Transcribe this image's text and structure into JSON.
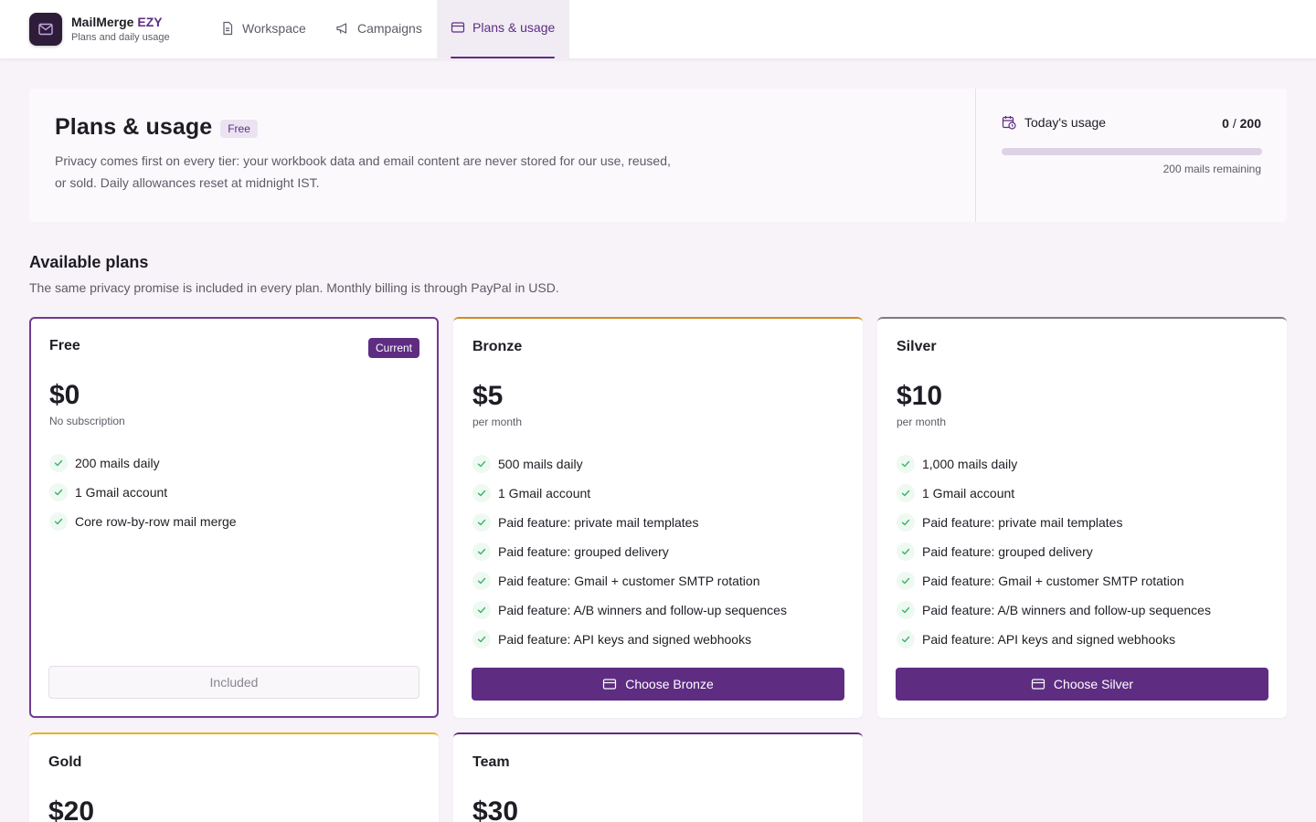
{
  "app": {
    "name": "MailMerge",
    "name_accent": "EZY",
    "subtitle": "Plans and daily usage"
  },
  "nav": {
    "tabs": [
      {
        "label": "Workspace",
        "icon": "document-icon"
      },
      {
        "label": "Campaigns",
        "icon": "megaphone-icon"
      },
      {
        "label": "Plans & usage",
        "icon": "credit-card-icon",
        "active": true
      }
    ]
  },
  "header": {
    "title": "Plans & usage",
    "plan_badge": "Free",
    "description": "Privacy comes first on every tier: your workbook data and email content are never stored for our use, reused, or sold. Daily allowances reset at midnight IST."
  },
  "usage": {
    "label": "Today's usage",
    "used": "0",
    "separator": "/",
    "limit": "200",
    "progress_fraction": 0,
    "remaining": "200 mails remaining"
  },
  "plans_section": {
    "title": "Available plans",
    "subtitle": "The same privacy promise is included in every plan. Monthly billing is through PayPal in USD."
  },
  "plans": [
    {
      "name": "Free",
      "badge": "Current",
      "price": "$0",
      "period": "No subscription",
      "accent": "#6e3a93",
      "features": [
        "200 mails daily",
        "1 Gmail account",
        "Core row-by-row mail merge"
      ],
      "button": "Included"
    },
    {
      "name": "Bronze",
      "price": "$5",
      "period": "per month",
      "accent": "#d08a22",
      "features": [
        "500 mails daily",
        "1 Gmail account",
        "Paid feature: private mail templates",
        "Paid feature: grouped delivery",
        "Paid feature: Gmail + customer SMTP rotation",
        "Paid feature: A/B winners and follow-up sequences",
        "Paid feature: API keys and signed webhooks"
      ],
      "button": "Choose Bronze"
    },
    {
      "name": "Silver",
      "price": "$10",
      "period": "per month",
      "accent": "#7c7a83",
      "features": [
        "1,000 mails daily",
        "1 Gmail account",
        "Paid feature: private mail templates",
        "Paid feature: grouped delivery",
        "Paid feature: Gmail + customer SMTP rotation",
        "Paid feature: A/B winners and follow-up sequences",
        "Paid feature: API keys and signed webhooks"
      ],
      "button": "Choose Silver"
    },
    {
      "name": "Gold",
      "price": "$20",
      "accent": "#e6b323"
    },
    {
      "name": "Team",
      "price": "$30",
      "accent": "#5e2d82"
    }
  ],
  "colors": {
    "brand": "#5e2d82",
    "check": "#3bb36b"
  }
}
